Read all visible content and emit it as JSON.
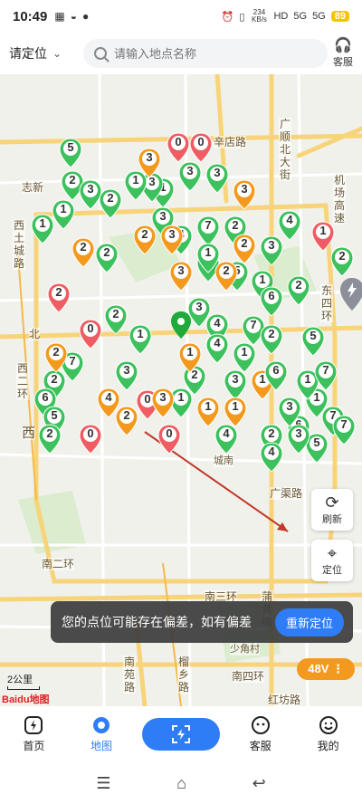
{
  "status": {
    "time": "10:49",
    "battery": "89",
    "net1": "234\nKB/s",
    "sig1": "5G",
    "sig2": "5G"
  },
  "header": {
    "location_label": "请定位",
    "search_placeholder": "请输入地点名称",
    "service_label": "客服"
  },
  "map": {
    "road_labels": [
      "辛店路",
      "广顺北大街",
      "机场高速",
      "西土城路",
      "志新",
      "北",
      "西二环",
      "西",
      "东四环",
      "广渠路",
      "南二环",
      "南三环",
      "蒲黄榆",
      "南苑路",
      "榴乡路",
      "南四环",
      "红坊路",
      "少角村",
      "城南"
    ],
    "pins": [
      {
        "n": "0",
        "c": "red"
      },
      {
        "n": "0",
        "c": "red"
      },
      {
        "n": "0",
        "c": "red"
      },
      {
        "n": "1",
        "c": "red"
      },
      {
        "n": "2",
        "c": "red"
      },
      {
        "n": "0",
        "c": "red"
      },
      {
        "n": "0",
        "c": "red"
      },
      {
        "n": "0",
        "c": "red"
      },
      {
        "n": "5",
        "c": "green"
      },
      {
        "n": "2",
        "c": "green"
      },
      {
        "n": "3",
        "c": "green"
      },
      {
        "n": "2",
        "c": "green"
      },
      {
        "n": "1",
        "c": "green"
      },
      {
        "n": "1",
        "c": "green"
      },
      {
        "n": "3",
        "c": "green"
      },
      {
        "n": "3",
        "c": "green"
      },
      {
        "n": "1",
        "c": "green"
      },
      {
        "n": "7",
        "c": "green"
      },
      {
        "n": "2",
        "c": "green"
      },
      {
        "n": "4",
        "c": "green"
      },
      {
        "n": "3",
        "c": "green"
      },
      {
        "n": "5",
        "c": "green"
      },
      {
        "n": "1",
        "c": "green"
      },
      {
        "n": "2",
        "c": "green"
      },
      {
        "n": "6",
        "c": "green"
      },
      {
        "n": "3",
        "c": "green"
      },
      {
        "n": "4",
        "c": "green"
      },
      {
        "n": "2",
        "c": "green"
      },
      {
        "n": "7",
        "c": "green"
      },
      {
        "n": "2",
        "c": "green"
      },
      {
        "n": "1",
        "c": "green"
      },
      {
        "n": "5",
        "c": "green"
      },
      {
        "n": "4",
        "c": "green"
      },
      {
        "n": "3",
        "c": "green"
      },
      {
        "n": "1",
        "c": "green"
      },
      {
        "n": "2",
        "c": "green"
      },
      {
        "n": "6",
        "c": "green"
      },
      {
        "n": "5",
        "c": "green"
      },
      {
        "n": "2",
        "c": "green"
      },
      {
        "n": "3",
        "c": "green"
      },
      {
        "n": "1",
        "c": "green"
      },
      {
        "n": "6",
        "c": "green"
      },
      {
        "n": "7",
        "c": "green"
      },
      {
        "n": "2",
        "c": "green"
      },
      {
        "n": "3",
        "c": "green"
      },
      {
        "n": "1",
        "c": "green"
      },
      {
        "n": "4",
        "c": "green"
      },
      {
        "n": "5",
        "c": "green"
      },
      {
        "n": "1",
        "c": "green"
      },
      {
        "n": "2",
        "c": "green"
      },
      {
        "n": "7",
        "c": "green"
      },
      {
        "n": "3",
        "c": "green"
      },
      {
        "n": "1",
        "c": "green"
      },
      {
        "n": "3",
        "c": "green"
      },
      {
        "n": "4",
        "c": "green"
      },
      {
        "n": "2",
        "c": "green"
      },
      {
        "n": "3",
        "c": "orange"
      },
      {
        "n": "2",
        "c": "orange"
      },
      {
        "n": "3",
        "c": "orange"
      },
      {
        "n": "2",
        "c": "orange"
      },
      {
        "n": "3",
        "c": "orange"
      },
      {
        "n": "1",
        "c": "orange"
      },
      {
        "n": "2",
        "c": "orange"
      },
      {
        "n": "2",
        "c": "orange"
      },
      {
        "n": "4",
        "c": "orange"
      },
      {
        "n": "1",
        "c": "orange"
      },
      {
        "n": "3",
        "c": "orange"
      },
      {
        "n": "2",
        "c": "orange"
      },
      {
        "n": "1",
        "c": "orange"
      },
      {
        "n": "2",
        "c": "orange"
      },
      {
        "n": "3",
        "c": "orange"
      },
      {
        "n": "1",
        "c": "orange"
      },
      {
        "n": "2",
        "c": "green"
      },
      {
        "n": "7",
        "c": "green"
      },
      {
        "n": "6",
        "c": "green"
      },
      {
        "n": "7",
        "c": "green"
      },
      {
        "n": "2",
        "c": "green"
      },
      {
        "n": "1",
        "c": "green"
      },
      {
        "n": "4",
        "c": "green"
      },
      {
        "n": "3",
        "c": "green"
      }
    ]
  },
  "controls": {
    "refresh_label": "刷新",
    "locate_label": "定位"
  },
  "toast": {
    "message": "您的点位可能存在偏差，如有偏差",
    "action": "重新定位"
  },
  "voltage": "48V",
  "scale_label": "2公里",
  "baidu_logo": "Baidu地图",
  "nav": {
    "home": "首页",
    "map": "地图",
    "service": "客服",
    "mine": "我的"
  },
  "colors": {
    "accent": "#2f7df6",
    "pin_green": "#3cc15c",
    "pin_orange": "#f39a1e",
    "pin_red": "#ef5c63"
  }
}
